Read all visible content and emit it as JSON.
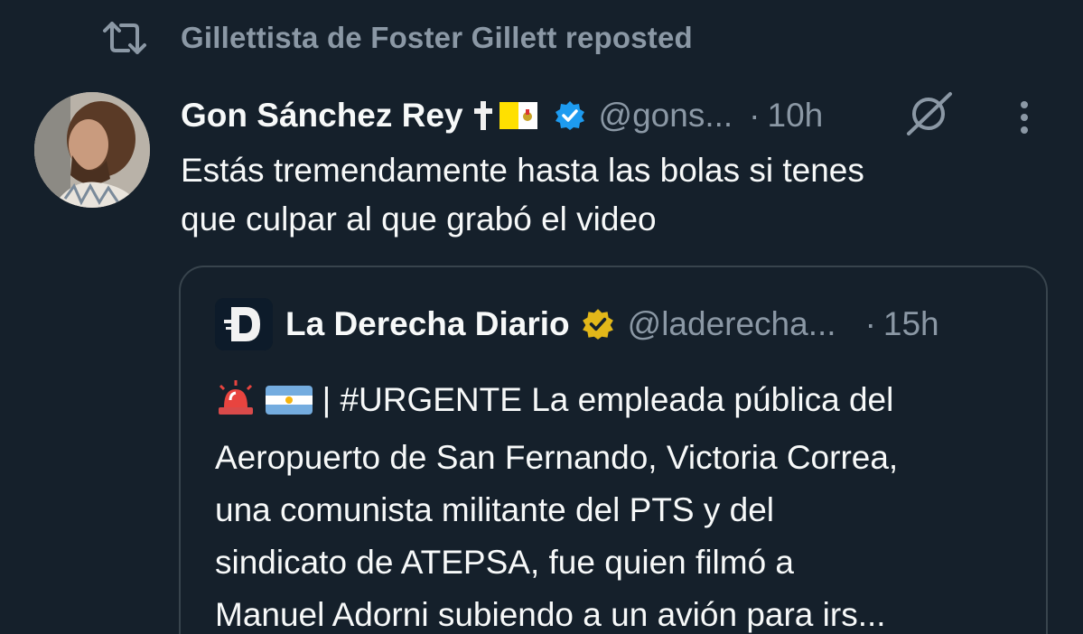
{
  "repost": {
    "icon": "repost-icon",
    "text": "Gillettista de Foster Gillett reposted"
  },
  "tweet": {
    "author_name": "Gon Sánchez Rey",
    "name_emojis": [
      "latin-cross-emoji",
      "vatican-flag-emoji"
    ],
    "verified_color": "#1d9bf0",
    "handle": "@gons...",
    "separator": "·",
    "time": "10h",
    "text_lines": [
      "Estás tremendamente hasta las bolas si tenes",
      "que culpar al que grabó el video"
    ]
  },
  "quote": {
    "author_name": "La Derecha Diario",
    "verified_color": "#e2b719",
    "handle": "@laderecha...",
    "separator": "·",
    "time": "15h",
    "text_prefix_emojis": [
      "police-light-emoji",
      "argentina-flag-emoji"
    ],
    "text_lines": [
      "| #URGENTE La empleada pública del",
      "Aeropuerto de San Fernando, Victoria Correa,",
      "una comunista militante del PTS y del",
      "sindicato de ATEPSA, fue quien filmó a",
      "Manuel Adorni subiendo a un avión para irs..."
    ]
  },
  "colors": {
    "background": "#15202b",
    "primary_text": "#f7f9f9",
    "secondary_text": "#8b98a5",
    "border": "#38444d"
  }
}
